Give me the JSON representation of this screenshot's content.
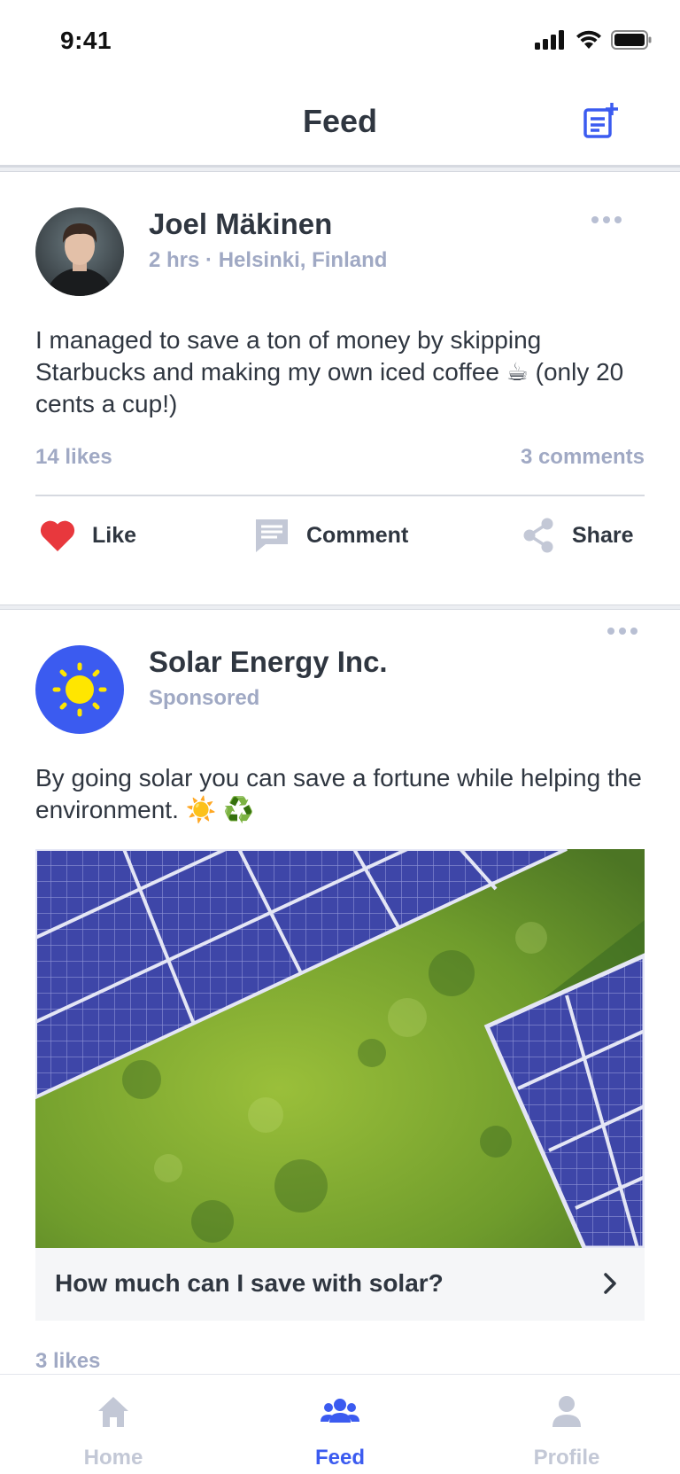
{
  "status_bar": {
    "time": "9:41"
  },
  "nav": {
    "title": "Feed",
    "compose_icon": "compose-icon"
  },
  "posts": [
    {
      "author": "Joel Mäkinen",
      "time": "2 hrs",
      "separator": "·",
      "location": "Helsinki, Finland",
      "text": "I managed to save a ton of money by skipping Starbucks and making my own iced coffee ☕ (only 20 cents a cup!)",
      "likes": "14 likes",
      "comments": "3 comments",
      "actions": {
        "like": "Like",
        "comment": "Comment",
        "share": "Share"
      },
      "like_color": "#e8383d"
    },
    {
      "author": "Solar Energy Inc.",
      "meta": "Sponsored",
      "text": "By going solar you can save a fortune while helping the environment. ☀️ ♻️",
      "cta": "How much can I save with solar?",
      "likes": "3 likes",
      "brand_color": "#3b5bf0"
    }
  ],
  "tabs": [
    {
      "label": "Home",
      "icon": "home-icon",
      "active": false
    },
    {
      "label": "Feed",
      "icon": "people-icon",
      "active": true
    },
    {
      "label": "Profile",
      "icon": "person-icon",
      "active": false
    }
  ],
  "colors": {
    "accent": "#3b5bf0",
    "muted": "#a0a9c4",
    "inactive_tab": "#c3c8d6"
  }
}
